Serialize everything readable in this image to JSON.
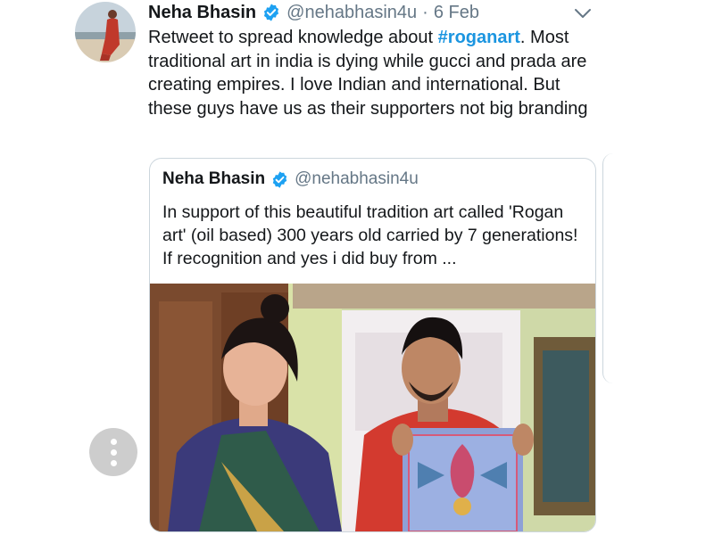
{
  "tweet": {
    "author_name": "Neha Bhasin",
    "handle": "@nehabhasin4u",
    "separator": "·",
    "date": "6 Feb",
    "text_before": "Retweet to spread knowledge about ",
    "hashtag": "#roganart",
    "text_after": ". Most traditional art in india is dying while gucci and prada are creating empires. I love Indian and international. But these guys have us as their supporters not big branding"
  },
  "quoted_tweet": {
    "author_name": "Neha Bhasin",
    "handle": "@nehabhasin4u",
    "text": "In support of this beautiful tradition art called 'Rogan art' (oil based) 300 years old carried by 7 generations! If recognition and yes i did buy from ..."
  },
  "icons": {
    "verified": "verified-badge-icon",
    "caret": "chevron-down-icon",
    "more": "more-options-icon"
  },
  "colors": {
    "accent": "#1b95e0",
    "verified": "#1da1f2",
    "text": "#14171a",
    "secondary": "#657786",
    "border": "#ccd6dd"
  }
}
